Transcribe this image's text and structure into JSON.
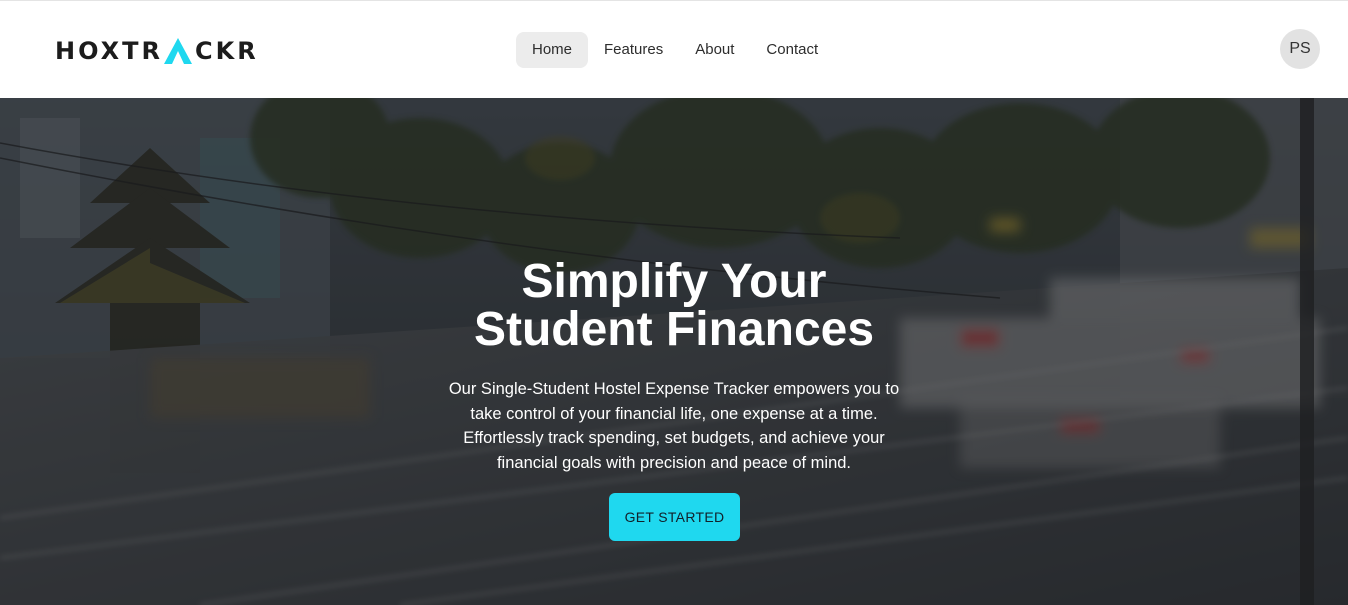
{
  "brand": {
    "logo_text_before": "HOXTR",
    "logo_text_after": "CKR",
    "accent_color": "#1fd8ef"
  },
  "nav": {
    "items": [
      {
        "label": "Home",
        "active": true
      },
      {
        "label": "Features",
        "active": false
      },
      {
        "label": "About",
        "active": false
      },
      {
        "label": "Contact",
        "active": false
      }
    ]
  },
  "user": {
    "initials": "PS"
  },
  "hero": {
    "title_line1": "Simplify Your",
    "title_line2": "Student Finances",
    "description": "Our Single-Student Hostel Expense Tracker empowers you to take control of your financial life, one expense at a time. Effortlessly track spending, set budgets, and achieve your financial goals with precision and peace of mind.",
    "cta_label": "GET STARTED",
    "background_image": "blurred-city-street-traffic-photo"
  }
}
